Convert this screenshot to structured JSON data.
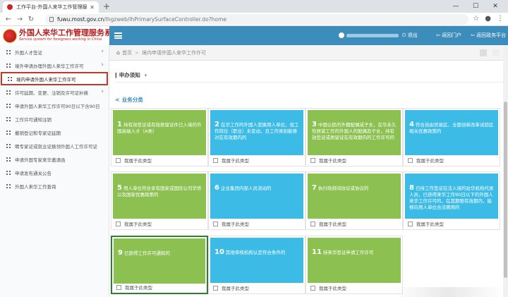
{
  "browser": {
    "tab_title": "工作平台-外国人来华工作管理服...",
    "url_host": "fuwu.most.gov.cn",
    "url_path": "/lhgzweb/lhPrimarySurfaceController.do?home"
  },
  "logo": {
    "title": "外国人来华工作管理服务系统",
    "subtitle": "Service system for foreigners working in China"
  },
  "header": {
    "logout": "退出",
    "back_home": "返回门户",
    "back_platform": "返回政务平台"
  },
  "sidebar": {
    "items": [
      {
        "label": "外国人才签证",
        "arrow": true,
        "active": false
      },
      {
        "label": "境外申请办理外国人来华工作许可",
        "arrow": true,
        "active": false
      },
      {
        "label": "境内申请外国人来华工作许可",
        "arrow": false,
        "active": true
      },
      {
        "label": "许可延期、变更、注销及许可证补换",
        "arrow": true,
        "active": false
      },
      {
        "label": "申请外国人来华工作许可90日以下含90日",
        "arrow": false,
        "active": false
      },
      {
        "label": "工作许可通知注销",
        "arrow": false,
        "active": false
      },
      {
        "label": "撤销登记和专家证延期",
        "arrow": false,
        "active": false
      },
      {
        "label": "聘专家证或就业证换领外国人工作许可证",
        "arrow": false,
        "active": false
      },
      {
        "label": "申请外国专家来华邀请函",
        "arrow": false,
        "active": false
      },
      {
        "label": "申请发布通关公告",
        "arrow": false,
        "active": false
      },
      {
        "label": "外国人来华工作查询",
        "arrow": false,
        "active": false
      }
    ]
  },
  "breadcrumb": {
    "home": "首页",
    "current": "境内申请外国人来华工作许可"
  },
  "notice": {
    "title": "申办须知"
  },
  "category": {
    "title": "业务分类"
  },
  "cards": [
    {
      "num": "1",
      "text": "持有效签证或有效居留证件已入境的外国高端人才（A类）",
      "color": "green",
      "check_label": "我属于此类型"
    },
    {
      "num": "2",
      "text": "在华工作的外国人变换用人单位，但工作岗位（职业）未变动，且工作类别能够对在有效期内的",
      "color": "blue",
      "check_label": "我属于此类型"
    },
    {
      "num": "3",
      "text": "中国公民的外籍配偶或子女，在华永久性居留工作的外国人的配偶及子女，持有效签证或居留证在有效期内的工作许可的",
      "color": "green",
      "check_label": "我属于此类型"
    },
    {
      "num": "4",
      "text": "符合自由贸易区、全面创新改革试验区相关优惠政策的",
      "color": "blue",
      "check_label": "我属于此类型"
    },
    {
      "num": "5",
      "text": "用人单位符合享有国家或国际公司华侨以及国家优惠政策的",
      "color": "green",
      "check_label": "我属于此类型"
    },
    {
      "num": "6",
      "text": "企业集团内部人员流动的",
      "color": "blue",
      "check_label": "我属于此类型"
    },
    {
      "num": "7",
      "text": "执行政府间协议或协议的",
      "color": "green",
      "check_label": "我属于此类型"
    },
    {
      "num": "8",
      "text": "已持工作签证在法入境的驻华机构代表人员，已获得来华工作90日以下的外国人来华工作许可的，在其期限有效期内，能够向用人单位合法聘用的",
      "color": "blue",
      "check_label": "我属于此类型"
    },
    {
      "num": "9",
      "text": "已获得工作许可通知的",
      "color": "green",
      "check_label": "我属于此类型",
      "selected": true
    },
    {
      "num": "10",
      "text": "其他审核机构认定符合条件的",
      "color": "blue",
      "check_label": "我属于此类型"
    },
    {
      "num": "11",
      "text": "持来华签证申请工作许可",
      "color": "green",
      "check_label": "我属于此类型"
    }
  ]
}
